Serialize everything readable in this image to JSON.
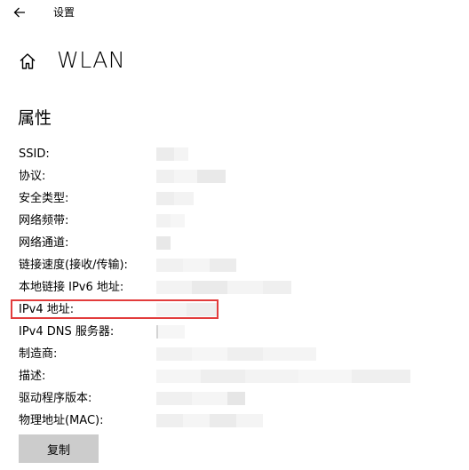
{
  "window": {
    "title": "设置",
    "back_icon": "back-arrow-icon"
  },
  "header": {
    "home_icon": "home-icon",
    "title": "WLAN"
  },
  "section": {
    "title": "属性"
  },
  "properties": [
    {
      "label": "SSID:"
    },
    {
      "label": "协议:"
    },
    {
      "label": "安全类型:"
    },
    {
      "label": "网络频带:"
    },
    {
      "label": "网络通道:"
    },
    {
      "label": "链接速度(接收/传输):"
    },
    {
      "label": "本地链接 IPv6 地址:"
    },
    {
      "label": "IPv4 地址:"
    },
    {
      "label": "IPv4 DNS 服务器:"
    },
    {
      "label": "制造商:"
    },
    {
      "label": "描述:"
    },
    {
      "label": "驱动程序版本:"
    },
    {
      "label": "物理地址(MAC):"
    }
  ],
  "highlight_color": "#e23c3c",
  "copy_button": {
    "label": "复制"
  }
}
